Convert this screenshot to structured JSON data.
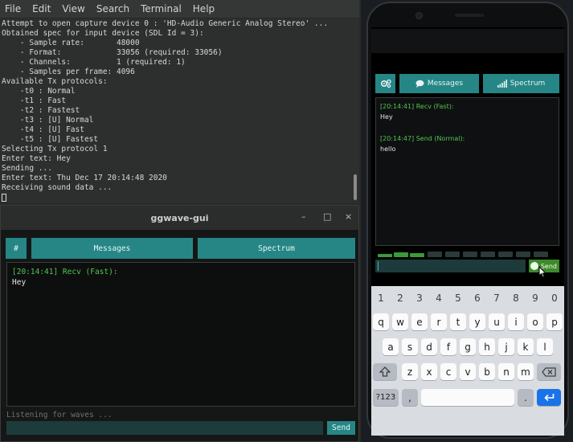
{
  "terminal": {
    "menu": [
      "File",
      "Edit",
      "View",
      "Search",
      "Terminal",
      "Help"
    ],
    "lines": [
      "Attempt to open capture device 0 : 'HD-Audio Generic Analog Stereo' ...",
      "Obtained spec for input device (SDL Id = 3):",
      "    - Sample rate:       48000",
      "    - Format:            33056 (required: 33056)",
      "    - Channels:          1 (required: 1)",
      "    - Samples per frame: 4096",
      "Available Tx protocols:",
      "    -t0 : Normal",
      "    -t1 : Fast",
      "    -t2 : Fastest",
      "    -t3 : [U] Normal",
      "    -t4 : [U] Fast",
      "    -t5 : [U] Fastest",
      "Selecting Tx protocol 1",
      "Enter text: Hey",
      "Sending ...",
      "Enter text: Thu Dec 17 20:14:48 2020",
      "Receiving sound data ..."
    ]
  },
  "gui": {
    "title": "ggwave-gui",
    "controls": {
      "minimize": "–",
      "maximize": "□",
      "close": "×"
    },
    "tabs": {
      "settings": "#",
      "messages": "Messages",
      "spectrum": "Spectrum"
    },
    "messages": [
      {
        "header": "[20:14:41] Recv (Fast):",
        "text": "Hey"
      }
    ],
    "status": "Listening for waves ...",
    "input_value": "",
    "send_label": "Send"
  },
  "phone": {
    "tabs": {
      "messages": "Messages",
      "spectrum": "Spectrum"
    },
    "messages": [
      {
        "header": "[20:14:41] Recv (Fast):",
        "text": "Hey"
      },
      {
        "header": "[20:14:47] Send (Normal):",
        "text": "hello"
      }
    ],
    "input_value": "",
    "send_label": "Send",
    "keyboard": {
      "numbers": [
        "1",
        "2",
        "3",
        "4",
        "5",
        "6",
        "7",
        "8",
        "9",
        "0"
      ],
      "row1": [
        "q",
        "w",
        "e",
        "r",
        "t",
        "y",
        "u",
        "i",
        "o",
        "p"
      ],
      "row2": [
        "a",
        "s",
        "d",
        "f",
        "g",
        "h",
        "j",
        "k",
        "l"
      ],
      "row3": [
        "z",
        "x",
        "c",
        "v",
        "b",
        "n",
        "m"
      ],
      "symbols": "?123",
      "comma": ",",
      "period": "."
    }
  },
  "colors": {
    "accent": "#268686",
    "recv": "#52c552",
    "send_button_phone": "#3d8a2a"
  }
}
